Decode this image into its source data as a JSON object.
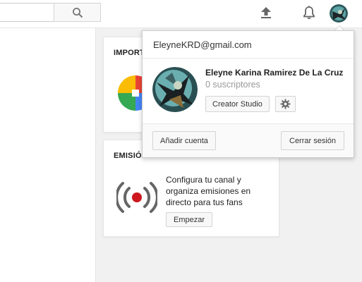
{
  "header": {
    "search_placeholder": "",
    "icons": [
      "search-icon",
      "upload-icon",
      "notifications-bell-icon",
      "account-avatar"
    ]
  },
  "cards": {
    "import": {
      "title": "IMPORT"
    },
    "live": {
      "title": "EMISIÓN EN DIRECTO",
      "description": "Configura tu canal y organiza emisiones en directo para tus fans",
      "button_label": "Empezar"
    }
  },
  "account_menu": {
    "email": "EleyneKRD@gmail.com",
    "name": "Eleyne Karina Ramirez De La Cruz",
    "subscribers": "0 suscriptores",
    "creator_studio_label": "Creator Studio",
    "add_account_label": "Añadir cuenta",
    "sign_out_label": "Cerrar sesión"
  },
  "colors": {
    "accent_red": "#cc181e",
    "icon_gray": "#666666"
  }
}
